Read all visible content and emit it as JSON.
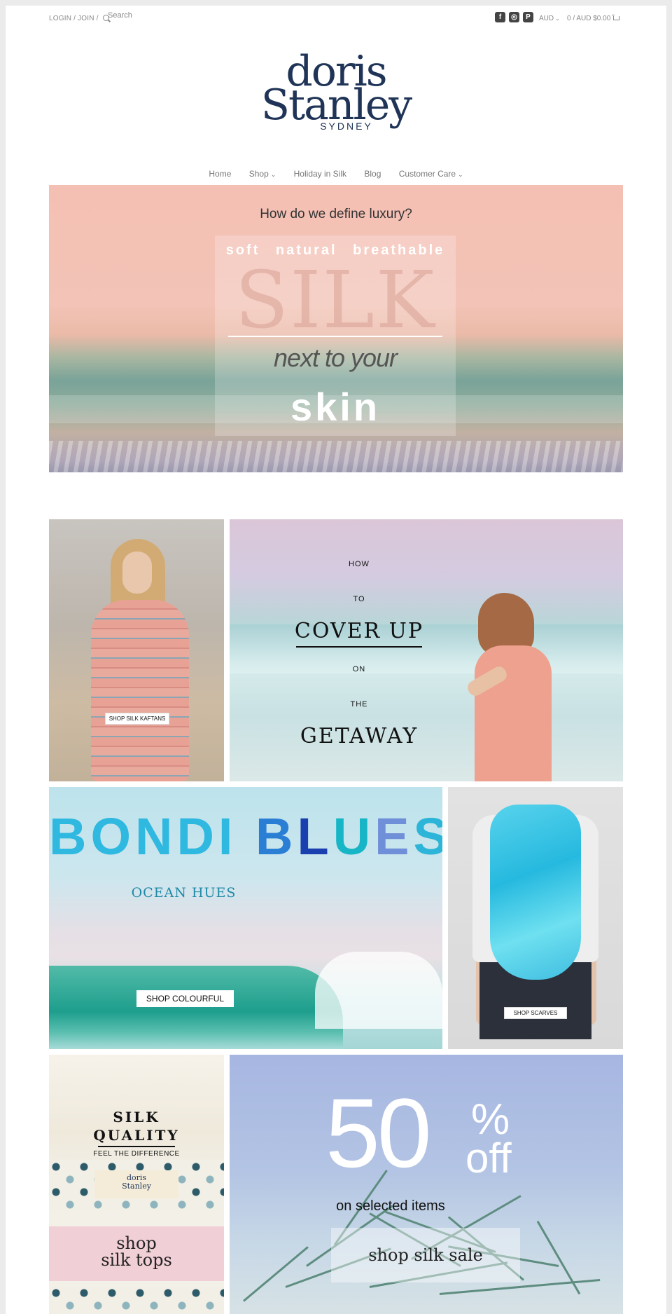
{
  "topbar": {
    "login_label": "LOGIN / JOIN /",
    "search_placeholder": "Search",
    "social": [
      {
        "icon": "facebook-icon",
        "glyph": "f"
      },
      {
        "icon": "instagram-icon",
        "glyph": "◎"
      },
      {
        "icon": "pinterest-icon",
        "glyph": "P"
      }
    ],
    "currency": "AUD",
    "cart": "0 / AUD $0.00"
  },
  "logo": {
    "line1": "doris",
    "line2": "Stanley",
    "line3": "SYDNEY",
    "color": "#1f3456"
  },
  "nav": {
    "home": "Home",
    "shop": "Shop",
    "holiday": "Holiday in Silk",
    "blog": "Blog",
    "care": "Customer Care"
  },
  "hero": {
    "question": "How do we define luxury?",
    "tagline": "soft natural breathable",
    "silk": "SILK",
    "next": "next to your",
    "skin": "skin"
  },
  "tiles": {
    "kaftans": {
      "button": "SHOP SILK KAFTANS"
    },
    "coverup": {
      "how": "HOW",
      "to": "TO",
      "cover": "COVER UP",
      "on": "ON",
      "the": "THE",
      "getaway": "GETAWAY"
    },
    "bondi": {
      "title_letters": [
        {
          "ch": "B",
          "color": "#2fb8e0"
        },
        {
          "ch": "O",
          "color": "#2fb8e0"
        },
        {
          "ch": "N",
          "color": "#2fb8e0"
        },
        {
          "ch": "D",
          "color": "#2fb8e0"
        },
        {
          "ch": "I",
          "color": "#2fb8e0"
        },
        {
          "ch": " ",
          "color": "#2fb8e0"
        },
        {
          "ch": "B",
          "color": "#2a7fd4"
        },
        {
          "ch": "L",
          "color": "#1a3fae"
        },
        {
          "ch": "U",
          "color": "#17b6c6"
        },
        {
          "ch": "E",
          "color": "#6f8fd8"
        },
        {
          "ch": "S",
          "color": "#2cb5d8"
        }
      ],
      "subtitle": "OCEAN HUES",
      "button": "SHOP COLOURFUL"
    },
    "scarves": {
      "button": "SHOP SCARVES"
    },
    "quality": {
      "line1": "SILK",
      "line2": "QUALITY",
      "line3": "FEEL THE DIFFERENCE",
      "label1": "doris",
      "label2": "Stanley",
      "shop1": "shop",
      "shop2": "silk tops"
    },
    "sale": {
      "number": "50",
      "percent": "%",
      "off": "off",
      "selected": "on selected items",
      "button": "shop silk sale"
    }
  }
}
